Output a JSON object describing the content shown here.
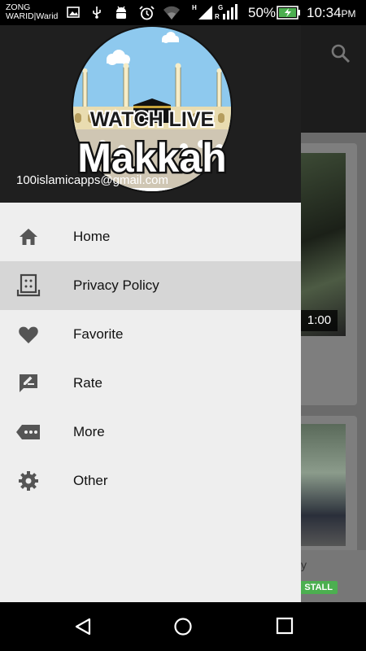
{
  "status_bar": {
    "carrier_line1": "ZONG",
    "carrier_line2": "WARID|Warid",
    "battery_percent": "50%",
    "time": "10:34",
    "time_suffix": "PM",
    "icons": [
      "image-icon",
      "usb-icon",
      "android-icon",
      "alarm-icon",
      "wifi-icon",
      "signal-h-icon",
      "signal-g-icon",
      "battery-charging-icon"
    ]
  },
  "drawer": {
    "header": {
      "logo_line1": "WATCH LIVE",
      "logo_line2": "Makkah",
      "email": "100islamicapps@gmail.com"
    },
    "items": [
      {
        "label": "Home",
        "icon": "home-icon",
        "active": false
      },
      {
        "label": "Privacy Policy",
        "icon": "privacy-policy-icon",
        "active": true
      },
      {
        "label": "Favorite",
        "icon": "heart-icon",
        "active": false
      },
      {
        "label": "Rate",
        "icon": "rate-icon",
        "active": false
      },
      {
        "label": "More",
        "icon": "more-icon",
        "active": false
      },
      {
        "label": "Other",
        "icon": "gear-icon",
        "active": false
      }
    ]
  },
  "background_app": {
    "video_duration": "1:00",
    "install_label": "STALL",
    "partial_text": "y"
  },
  "nav_bar": {
    "buttons": [
      "back-icon",
      "home-circle-icon",
      "recents-icon"
    ]
  },
  "colors": {
    "drawer_bg": "#eeeeee",
    "active_item_bg": "#d6d6d6",
    "header_bg": "#1f1f1f",
    "icon_gray": "#555555",
    "install_green": "#4caf50"
  }
}
